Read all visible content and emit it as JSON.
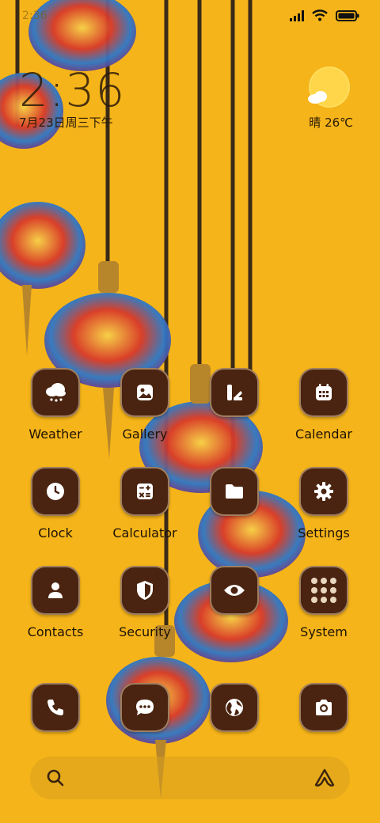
{
  "status_bar": {
    "time": "2:36",
    "icons": [
      "signal-icon",
      "wifi-icon",
      "battery-icon"
    ]
  },
  "clock_widget": {
    "time": "2:36",
    "date": "7月23日周三下午"
  },
  "weather_widget": {
    "condition": "晴",
    "temperature": "26℃",
    "icon": "sun-cloud-icon"
  },
  "apps": [
    {
      "label": "Weather",
      "icon": "weather-icon"
    },
    {
      "label": "Gallery",
      "icon": "gallery-icon"
    },
    {
      "label": "",
      "icon": "themes-icon"
    },
    {
      "label": "Calendar",
      "icon": "calendar-icon"
    },
    {
      "label": "Clock",
      "icon": "clock-icon"
    },
    {
      "label": "Calculator",
      "icon": "calculator-icon"
    },
    {
      "label": "",
      "icon": "file-manager-icon"
    },
    {
      "label": "Settings",
      "icon": "gear-icon"
    },
    {
      "label": "Contacts",
      "icon": "contacts-icon"
    },
    {
      "label": "Security",
      "icon": "shield-icon"
    },
    {
      "label": "",
      "icon": "eye-icon"
    },
    {
      "label": "System",
      "icon": "folder-grid-icon"
    }
  ],
  "dock": [
    {
      "icon": "phone-icon"
    },
    {
      "icon": "message-icon"
    },
    {
      "icon": "browser-icon"
    },
    {
      "icon": "camera-icon"
    }
  ],
  "colors": {
    "wallpaper": "#f5b419",
    "icon_bg": "#4a2410",
    "text": "#1d1206"
  }
}
